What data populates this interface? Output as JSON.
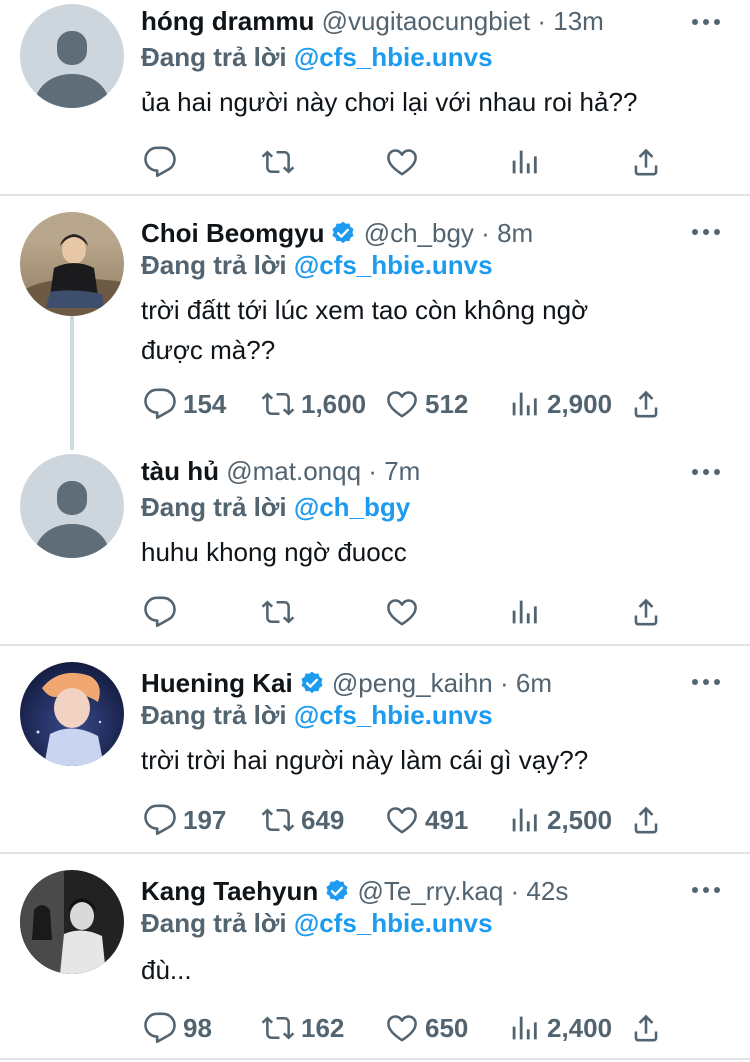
{
  "colors": {
    "accent": "#1d9bf0",
    "muted": "#536471",
    "text": "#0f1419",
    "divider": "#e1e4e8"
  },
  "icons": {
    "reply": "reply-icon",
    "retweet": "retweet-icon",
    "like": "like-icon",
    "views": "views-icon",
    "share": "share-icon",
    "more": "more-icon",
    "verified": "verified-badge-icon"
  },
  "tweets": [
    {
      "name": "hóng drammu",
      "handle": "@vugitaocungbiet",
      "dot": "·",
      "time": "13m",
      "reply_prefix": "Đang trả lời",
      "reply_to": "@cfs_hbie.unvs",
      "text": [
        "ủa hai người này chơi lại với nhau roi hả??"
      ],
      "verified": false,
      "counts": {
        "replies": "",
        "retweets": "",
        "likes": "",
        "views": ""
      }
    },
    {
      "name": "Choi Beomgyu",
      "handle": "@ch_bgy",
      "dot": "·",
      "time": "8m",
      "reply_prefix": "Đang trả lời",
      "reply_to": "@cfs_hbie.unvs",
      "text": [
        "trời đấtt tới lúc xem tao còn không ngờ",
        "được mà??"
      ],
      "verified": true,
      "counts": {
        "replies": "154",
        "retweets": "1,600",
        "likes": "512",
        "views": "2,900"
      }
    },
    {
      "name": "tàu hủ",
      "handle": "@mat.onqq",
      "dot": "·",
      "time": "7m",
      "reply_prefix": "Đang trả lời",
      "reply_to": "@ch_bgy",
      "text": [
        "huhu khong ngờ đuocc"
      ],
      "verified": false,
      "counts": {
        "replies": "",
        "retweets": "",
        "likes": "",
        "views": ""
      }
    },
    {
      "name": "Huening Kai",
      "handle": "@peng_kaihn",
      "dot": "·",
      "time": "6m",
      "reply_prefix": "Đang trả lời",
      "reply_to": "@cfs_hbie.unvs",
      "text": [
        "trời trời hai người này làm cái gì vạy??"
      ],
      "verified": true,
      "counts": {
        "replies": "197",
        "retweets": "649",
        "likes": "491",
        "views": "2,500"
      }
    },
    {
      "name": "Kang Taehyun",
      "handle": "@Te_rry.kaq",
      "dot": "·",
      "time": "42s",
      "reply_prefix": "Đang trả lời",
      "reply_to": "@cfs_hbie.unvs",
      "text": [
        "đù..."
      ],
      "verified": true,
      "counts": {
        "replies": "98",
        "retweets": "162",
        "likes": "650",
        "views": "2,400"
      }
    }
  ]
}
